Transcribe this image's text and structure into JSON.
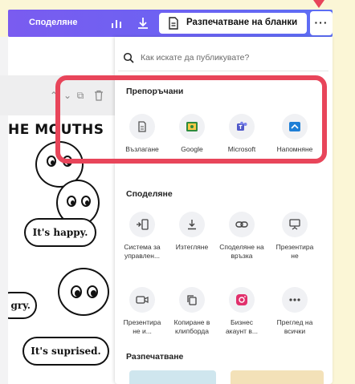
{
  "topbar": {
    "share_label": "Споделяне",
    "print_label": "Разпечатване на бланки",
    "more_label": "···"
  },
  "search": {
    "placeholder": "Как искате да публикувате?"
  },
  "recommended": {
    "title": "Препоръчани",
    "items": [
      {
        "label": "Възлагане",
        "icon": "assign-icon"
      },
      {
        "label": "Google",
        "icon": "google-classroom-icon"
      },
      {
        "label": "Microsoft",
        "icon": "microsoft-teams-icon"
      },
      {
        "label": "Напомняне",
        "icon": "reminder-icon"
      }
    ]
  },
  "share": {
    "title": "Споделяне",
    "items": [
      {
        "label": "Система за управлен...",
        "icon": "lms-icon"
      },
      {
        "label": "Изтегляне",
        "icon": "download-icon"
      },
      {
        "label": "Споделяне на връзка",
        "icon": "link-icon"
      },
      {
        "label": "Презентира не",
        "icon": "present-icon"
      },
      {
        "label": "Презентира не и...",
        "icon": "present-record-icon"
      },
      {
        "label": "Копиране в клипборда",
        "icon": "copy-icon"
      },
      {
        "label": "Бизнес акаунт в...",
        "icon": "instagram-icon"
      },
      {
        "label": "Преглед на всички",
        "icon": "more-icon"
      }
    ]
  },
  "print": {
    "title": "Разпечатване"
  },
  "canvas": {
    "heading": "HE MOUTHS",
    "bubbles": [
      "It's happy.",
      "gry.",
      "It's suprised."
    ]
  },
  "colors": {
    "accent": "#7a5cf0",
    "highlight": "#e8455a",
    "background": "#fbf6d6"
  }
}
